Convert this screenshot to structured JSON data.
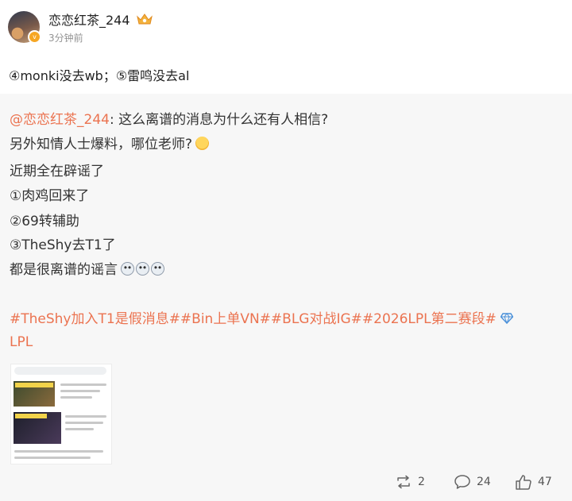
{
  "user": {
    "name": "恋恋红茶_244",
    "time": "3分钟前"
  },
  "repost": {
    "text": "④monki没去wb；⑤雷鸣没去al"
  },
  "original": {
    "mention": "@恋恋红茶_244",
    "line1_text": ": 这么离谱的消息为什么还有人相信?",
    "line2": "另外知情人士爆料，哪位老师?",
    "line3": "近期全在辟谣了",
    "line4": "①肉鸡回来了",
    "line5": "②69转辅助",
    "line6": "③TheShy去T1了",
    "line7": "都是很离谱的谣言",
    "hashtags": "#TheShy加入T1是假消息##Bin上单VN##BLG对战IG##2026LPL第二赛段#",
    "lpl_tag": "LPL"
  },
  "actions": {
    "reposts": "2",
    "comments": "24",
    "likes": "47"
  },
  "colors": {
    "accent": "#eb7350",
    "quote_bg": "#f7f7f7"
  },
  "icons": [
    "vip-crown-icon",
    "thinking-emoji-icon",
    "crying-emoji-icon",
    "diamond-icon",
    "repost-icon",
    "comment-icon",
    "like-icon"
  ]
}
